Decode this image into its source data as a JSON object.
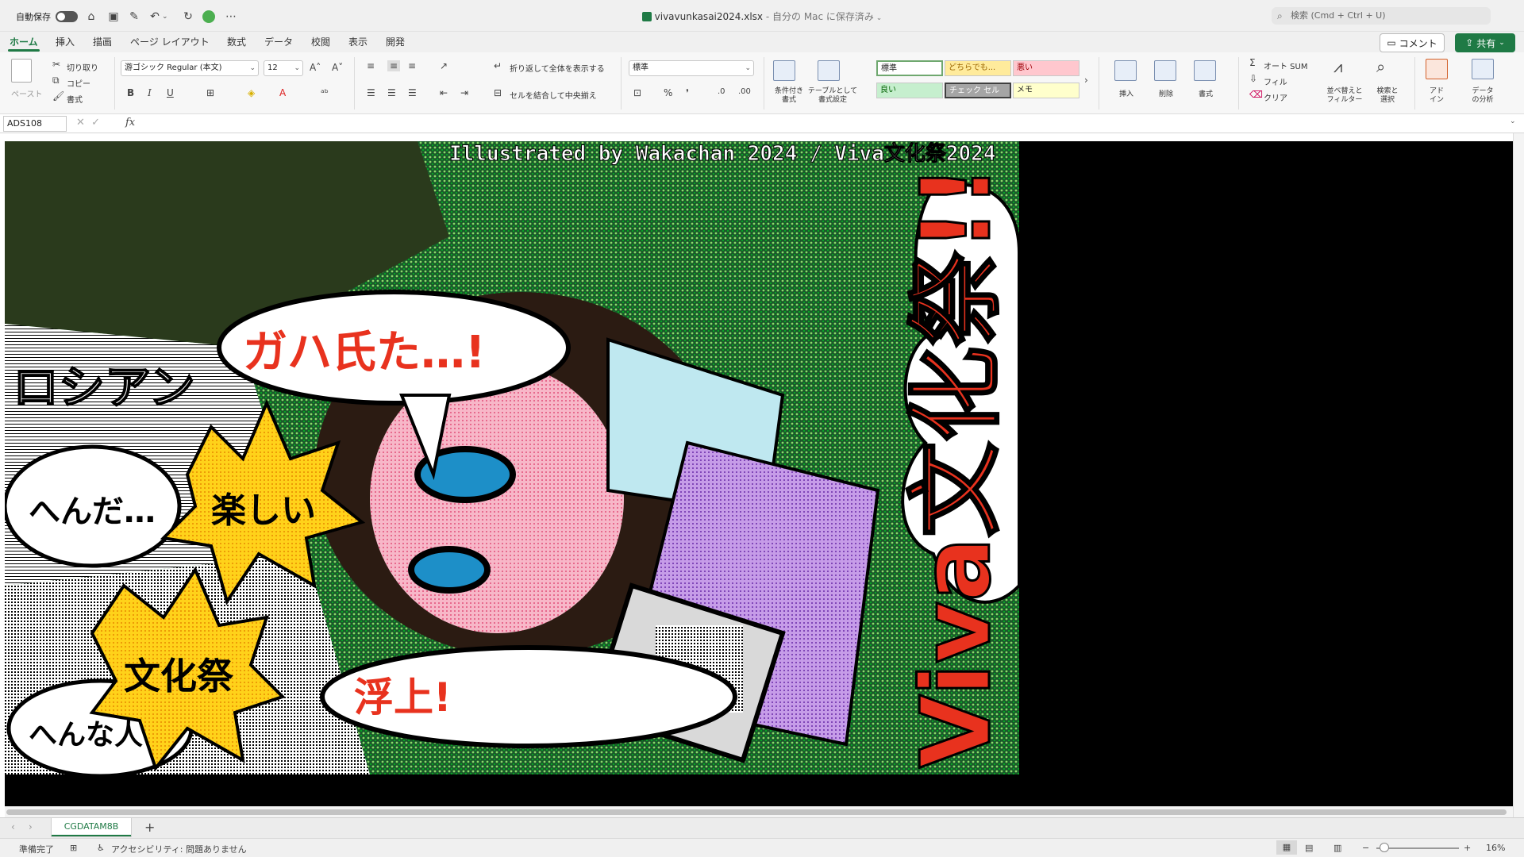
{
  "titlebar": {
    "autosave_label": "自動保存",
    "doc_title": "vivavunkasai2024.xlsx",
    "doc_subtitle": "自分の Mac に保存済み",
    "search_placeholder": "検索 (Cmd + Ctrl + U)"
  },
  "tabs": [
    "ホーム",
    "挿入",
    "描画",
    "ページ レイアウト",
    "数式",
    "データ",
    "校閲",
    "表示",
    "開発"
  ],
  "active_tab": "ホーム",
  "header_buttons": {
    "comment": "コメント",
    "share": "共有"
  },
  "ribbon": {
    "paste": "ペースト",
    "cut": "切り取り",
    "copy": "コピー",
    "format_painter": "書式",
    "font_name": "游ゴシック Regular (本文)",
    "font_size": "12",
    "bold": "B",
    "italic": "I",
    "underline": "U",
    "wrap_text": "折り返して全体を表示する",
    "merge_center": "セルを結合して中央揃え",
    "number_format": "標準",
    "conditional_format": "条件付き\n書式",
    "format_as_table": "テーブルとして\n書式設定",
    "styles": {
      "normal": "標準",
      "neutral": "どちらでも...",
      "bad": "悪い",
      "good": "良い",
      "check_cell": "チェック セル",
      "note": "メモ"
    },
    "insert": "挿入",
    "delete": "削除",
    "format": "書式",
    "autosum": "オート SUM",
    "fill": "フィル",
    "clear": "クリア",
    "sort_filter": "並べ替えと\nフィルター",
    "find_select": "検索と\n選択",
    "addins": "アド\nイン",
    "analyze_data": "データ\nの分析"
  },
  "formula_bar": {
    "name_box": "ADS108",
    "fx": "fx",
    "formula": ""
  },
  "artwork": {
    "credit": "Illustrated by Wakachan 2024 / Viva文化祭2024",
    "headline": "Viva文化祭!!",
    "bubbles": [
      "ガハ氏た…!",
      "ロシアン",
      "へんだ…",
      "文化祭",
      "楽しい",
      "浮上!",
      "へんな人"
    ]
  },
  "sheet_tabs": [
    "CGDATAM8B"
  ],
  "statusbar": {
    "ready": "準備完了",
    "accessibility": "アクセシビリティ: 問題ありません",
    "zoom": "16%"
  },
  "colors": {
    "accent": "#1f7a45",
    "headline_red": "#e8321e",
    "good_bg": "#c6efce",
    "bad_bg": "#ffc7ce",
    "neutral_bg": "#ffeb9c",
    "check_bg": "#a5a5a5",
    "note_bg": "#ffffcc"
  }
}
